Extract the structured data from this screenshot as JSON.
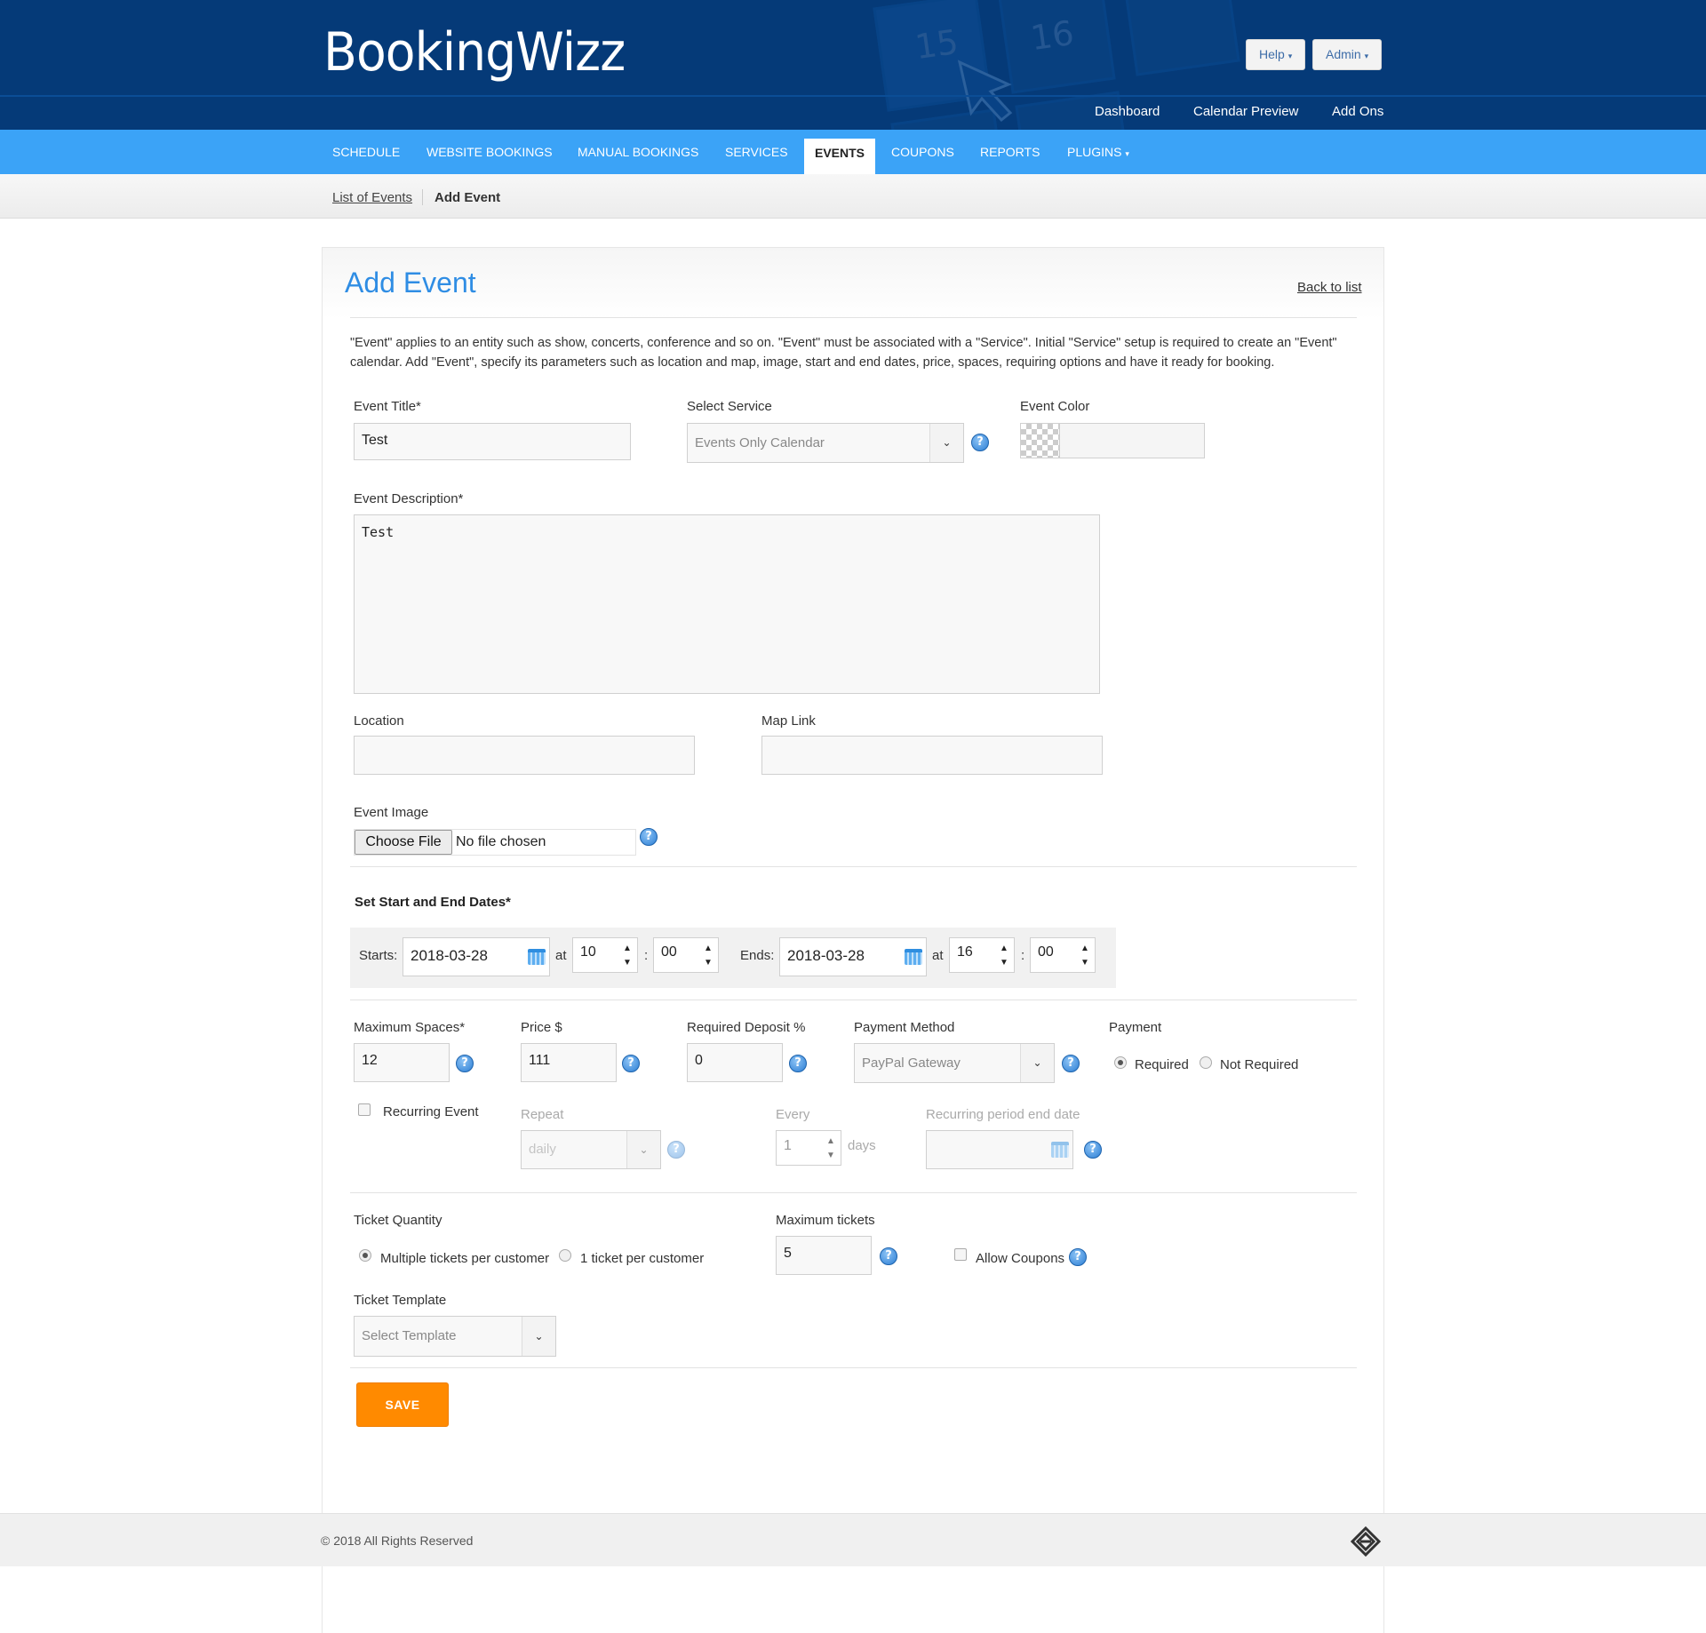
{
  "header": {
    "logo": "BookingWizz",
    "help_label": "Help",
    "admin_label": "Admin",
    "top_links": [
      "Dashboard",
      "Calendar Preview",
      "Add Ons"
    ],
    "bg_numbers": [
      "15",
      "16"
    ]
  },
  "nav": {
    "items": [
      "SCHEDULE",
      "WEBSITE BOOKINGS",
      "MANUAL BOOKINGS",
      "SERVICES",
      "EVENTS",
      "COUPONS",
      "REPORTS",
      "PLUGINS"
    ],
    "active": "EVENTS"
  },
  "breadcrumb": {
    "link": "List of Events",
    "current": "Add Event"
  },
  "panel": {
    "title": "Add Event",
    "back_link": "Back to list",
    "description": "\"Event\" applies to an entity such as show, concerts, conference and so on. \"Event\" must be associated with a \"Service\". Initial \"Service\" setup is required to create an \"Event\" calendar. Add \"Event\", specify its parameters such as location and map, image, start and end dates, price, spaces, requiring options and have it ready for booking."
  },
  "form": {
    "event_title_label": "Event Title*",
    "event_title_value": "Test",
    "select_service_label": "Select Service",
    "select_service_value": "Events Only Calendar",
    "event_color_label": "Event Color",
    "event_description_label": "Event Description*",
    "event_description_value": "Test",
    "location_label": "Location",
    "map_link_label": "Map Link",
    "event_image_label": "Event Image",
    "choose_file_label": "Choose File",
    "no_file_text": "No file chosen",
    "dates_heading": "Set Start and End Dates*",
    "starts_label": "Starts:",
    "start_date": "2018-03-28",
    "at_label": "at",
    "start_hour": "10",
    "start_min": "00",
    "colon": ":",
    "ends_label": "Ends:",
    "end_date": "2018-03-28",
    "end_hour": "16",
    "end_min": "00",
    "max_spaces_label": "Maximum Spaces*",
    "max_spaces_value": "12",
    "price_label": "Price $",
    "price_value": "111",
    "deposit_label": "Required Deposit %",
    "deposit_value": "0",
    "payment_method_label": "Payment Method",
    "payment_method_value": "PayPal Gateway",
    "payment_label": "Payment",
    "payment_required": "Required",
    "payment_not_required": "Not Required",
    "recurring_label": "Recurring Event",
    "repeat_label": "Repeat",
    "repeat_value": "daily",
    "every_label": "Every",
    "every_value": "1",
    "days_label": "days",
    "recurring_end_label": "Recurring period end date",
    "ticket_qty_label": "Ticket Quantity",
    "multiple_tickets": "Multiple tickets per customer",
    "one_ticket": "1 ticket per customer",
    "max_tickets_label": "Maximum tickets",
    "max_tickets_value": "5",
    "allow_coupons": "Allow Coupons",
    "ticket_template_label": "Ticket Template",
    "ticket_template_value": "Select Template",
    "save_label": "SAVE"
  },
  "footer": {
    "copyright": "© 2018 All Rights Reserved"
  },
  "colors": {
    "header_bg": "#053a78",
    "nav_bg": "#3ba3f7",
    "title_blue": "#2f8de4",
    "save_orange": "#ff8a00"
  },
  "icons": [
    "help-icon",
    "calendar-icon",
    "chevron-down-icon",
    "logo-mark-icon"
  ]
}
